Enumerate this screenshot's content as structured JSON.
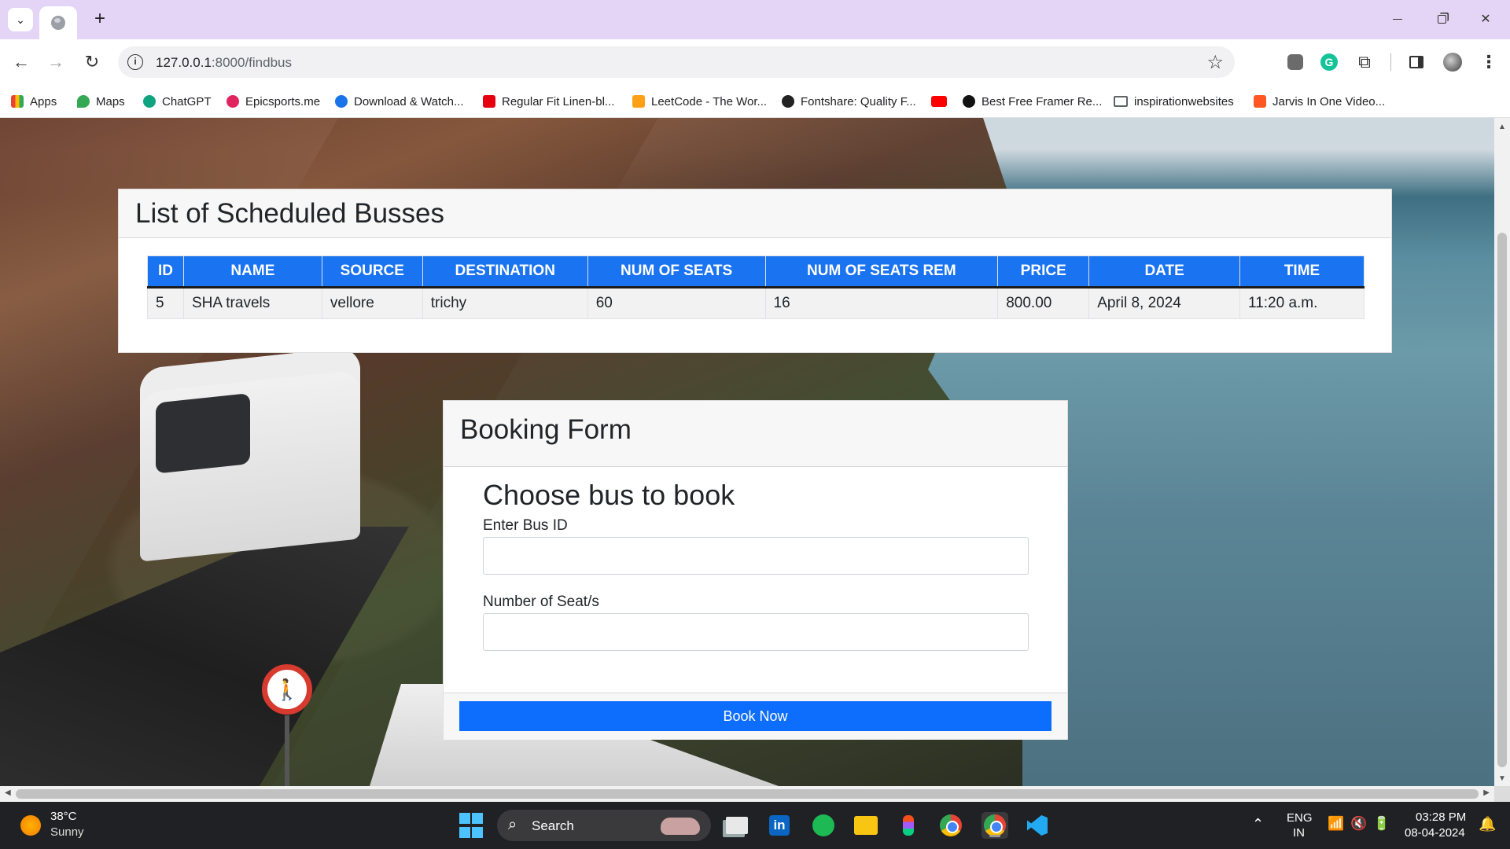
{
  "browser": {
    "url_host": "127.0.0.1",
    "url_rest": ":8000/findbus",
    "new_tab_glyph": "+",
    "bookmarks": [
      {
        "label": "Apps",
        "icon": "apps-grid-icon",
        "color": "#4285f4"
      },
      {
        "label": "Maps",
        "icon": "maps-pin-icon",
        "color": "#34a853"
      },
      {
        "label": "ChatGPT",
        "icon": "chatgpt-icon",
        "color": "#10a37f"
      },
      {
        "label": "Epicsports.me",
        "icon": "epicsports-icon",
        "color": "#e0245e"
      },
      {
        "label": "Download & Watch...",
        "icon": "play-icon",
        "color": "#1a73e8"
      },
      {
        "label": "Regular Fit Linen-bl...",
        "icon": "hm-icon",
        "color": "#e50010"
      },
      {
        "label": "LeetCode - The Wor...",
        "icon": "leetcode-icon",
        "color": "#ffa116"
      },
      {
        "label": "Fontshare: Quality F...",
        "icon": "fontshare-icon",
        "color": "#222222"
      },
      {
        "label": "",
        "icon": "youtube-icon",
        "color": "#ff0000"
      },
      {
        "label": "Best Free Framer Re...",
        "icon": "framer-icon",
        "color": "#111111"
      },
      {
        "label": "inspirationwebsites",
        "icon": "folder-icon",
        "color": "#5f6368"
      },
      {
        "label": "Jarvis In One Video...",
        "icon": "blogger-icon",
        "color": "#ff5722"
      }
    ]
  },
  "list": {
    "title": "List of Scheduled Busses",
    "columns": [
      "ID",
      "NAME",
      "SOURCE",
      "DESTINATION",
      "NUM OF SEATS",
      "NUM OF SEATS REM",
      "PRICE",
      "DATE",
      "TIME"
    ],
    "rows": [
      [
        "5",
        "SHA travels",
        "vellore",
        "trichy",
        "60",
        "16",
        "800.00",
        "April 8, 2024",
        "11:20 a.m."
      ]
    ]
  },
  "booking": {
    "header": "Booking Form",
    "title": "Choose bus to book",
    "bus_id_label": "Enter Bus ID",
    "bus_id_value": "",
    "seats_label": "Number of Seat/s",
    "seats_value": "",
    "submit_label": "Book Now"
  },
  "taskbar": {
    "temperature": "38°C",
    "weather": "Sunny",
    "search_label": "Search",
    "lang_line1": "ENG",
    "lang_line2": "IN",
    "time": "03:28 PM",
    "date": "08-04-2024"
  },
  "colors": {
    "table_header": "#1a73f0",
    "button": "#0d6efd",
    "tab_strip": "#e4d4f6"
  }
}
